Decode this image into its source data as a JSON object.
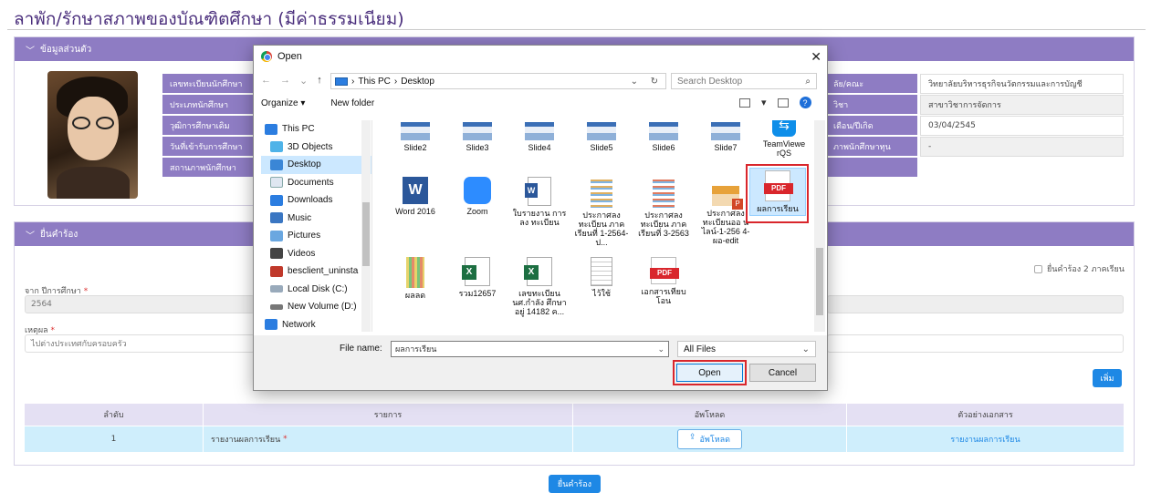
{
  "page": {
    "title": "ลาพัก/รักษาสภาพของบัณฑิตศึกษา (มีค่าธรรมเนียม)"
  },
  "personal": {
    "header": "ข้อมูลส่วนตัว",
    "left_labels": [
      "เลขทะเบียนนักศึกษา",
      "ประเภทนักศึกษา",
      "วุฒิการศึกษาเดิม",
      "วันที่เข้ารับการศึกษา",
      "สถานภาพนักศึกษา"
    ],
    "right_labels": [
      "ลัย/คณะ",
      "วิชา",
      "เดือน/ปีเกิด",
      "ภาพนักศึกษาทุน"
    ],
    "right_values": [
      "วิทยาลัยบริหารธุรกิจนวัตกรรมและการบัญชี",
      "สาขาวิชาการจัดการ",
      "03/04/2545",
      "-"
    ]
  },
  "request": {
    "header": "ยื่นคำร้อง",
    "two_semester_label": "ยื่นคำร้อง 2 ภาคเรียน",
    "year_label": "จาก ปีการศึกษา",
    "year_value": "2564",
    "reason_label": "เหตุผล",
    "reason_value": "ไปต่างประเทศกับครอบครัว",
    "add_button": "เพิ่ม",
    "table": {
      "headers": [
        "ลำดับ",
        "รายการ",
        "อัพโหลด",
        "ตัวอย่างเอกสาร"
      ],
      "row": {
        "index": "1",
        "item": "รายงานผลการเรียน",
        "upload": "อัพโหลด",
        "sample": "รายงานผลการเรียน"
      }
    },
    "submit_button": "ยื่นคำร้อง"
  },
  "dialog": {
    "title": "Open",
    "close": "✕",
    "breadcrumb": [
      "This PC",
      "Desktop"
    ],
    "search_placeholder": "Search Desktop",
    "organize": "Organize ▾",
    "new_folder": "New folder",
    "sidebar": [
      "This PC",
      "3D Objects",
      "Desktop",
      "Documents",
      "Downloads",
      "Music",
      "Pictures",
      "Videos",
      "besclient_uninsta",
      "Local Disk (C:)",
      "New Volume (D:)",
      "Network"
    ],
    "files_row1": [
      "Slide2",
      "Slide3",
      "Slide4",
      "Slide5",
      "Slide6",
      "Slide7",
      "TeamViewe rQS"
    ],
    "files_row2": [
      "Word 2016",
      "Zoom",
      "ใบรายงาน การลง ทะเบียน",
      "ประกาศลง ทะเบียน ภาค เรียนที่ 1-2564-ป...",
      "ประกาศลง ทะเบียน ภาค เรียนที่ 3-2563",
      "ประกาศลง ทะเบียนออ นไลน์-1-256 4-ผอ-edit",
      "ผลการเรียน"
    ],
    "files_row3": [
      "ผลลด",
      "รวม12657",
      "เลขทะเบียน นศ.กำลัง ศึกษาอยู่ 14182 ค...",
      "ไว้ใช้",
      "เอกสารเทียบ โอน"
    ],
    "file_name_label": "File name:",
    "file_name_value": "ผลการเรียน",
    "filter": "All Files",
    "open_button": "Open",
    "cancel_button": "Cancel"
  },
  "colors": {
    "accent": "#8e7cc3",
    "title": "#4a2e7c",
    "button": "#1e88e5",
    "highlight": "#d9262c",
    "row": "#cfeefc"
  }
}
